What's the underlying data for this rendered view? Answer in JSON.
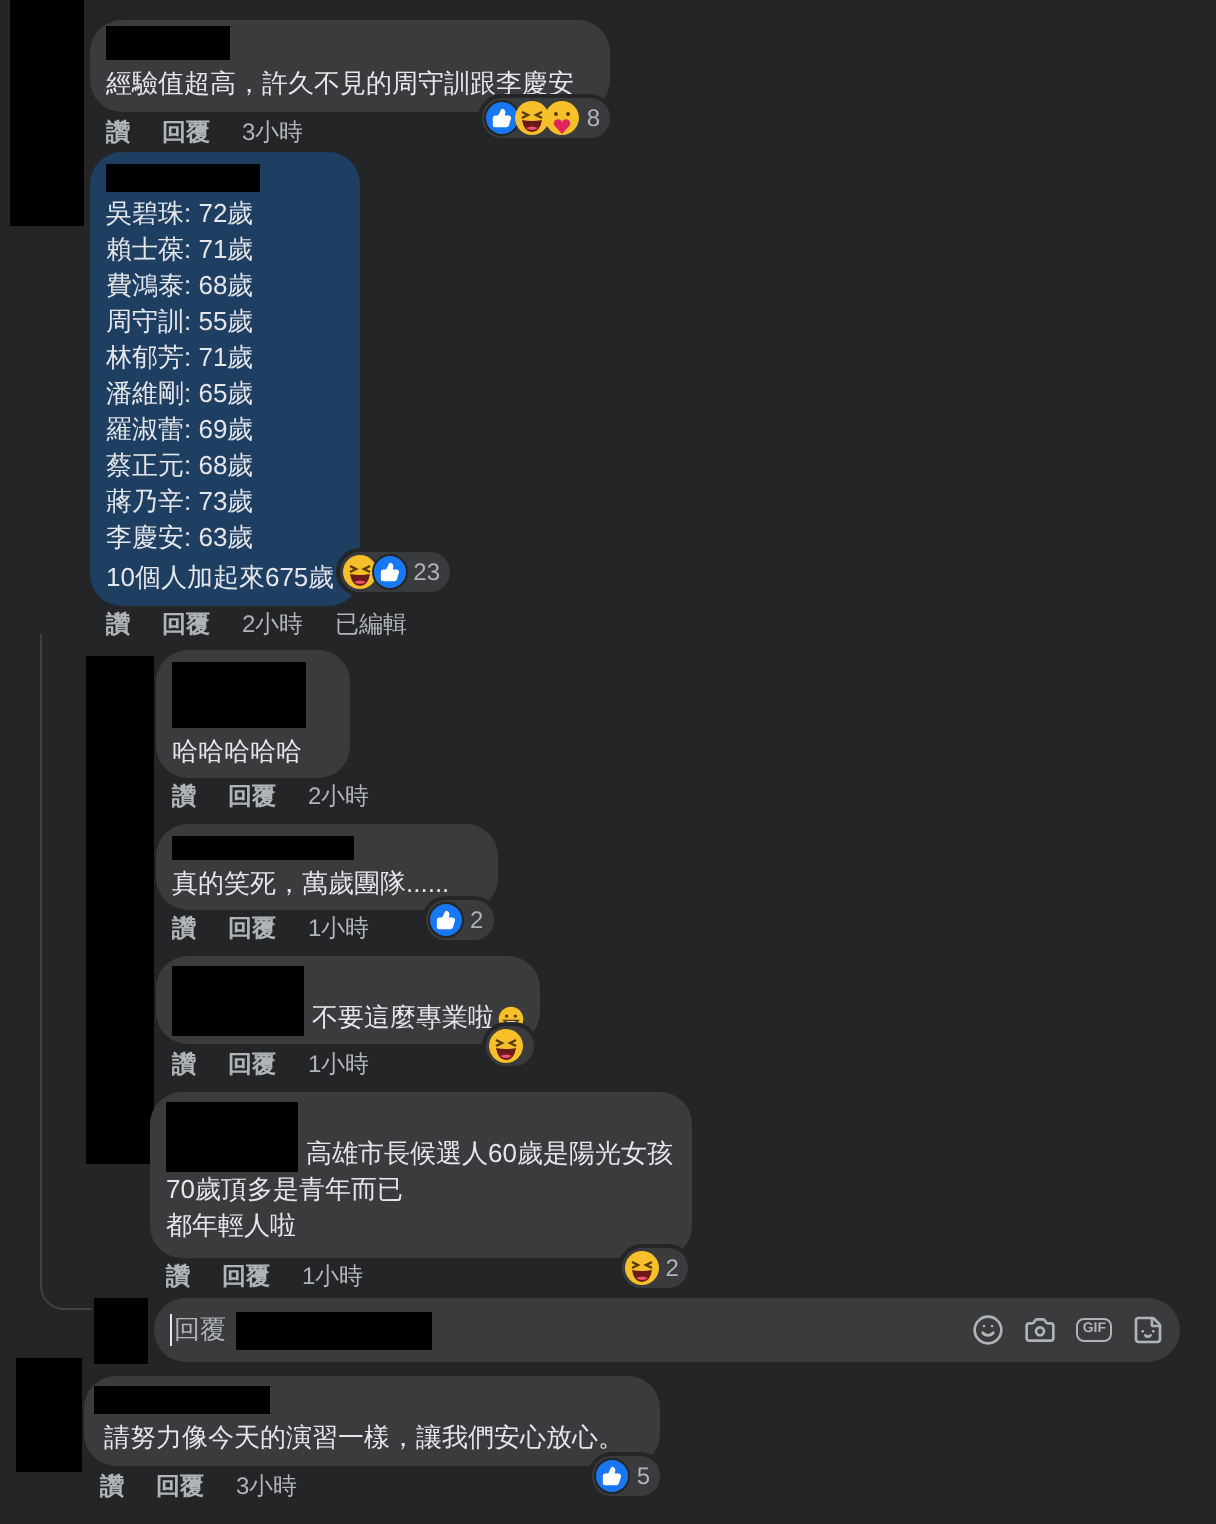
{
  "comments": [
    {
      "lines": [
        "經驗值超高，許久不見的周守訓跟李慶安"
      ],
      "reactions": [
        {
          "kind": "like"
        },
        {
          "kind": "haha"
        },
        {
          "kind": "care"
        }
      ],
      "count": "8",
      "actions": [
        "讚",
        "回覆",
        "3小時"
      ],
      "highlighted": false
    },
    {
      "lines": [
        "吳碧珠: 72歲",
        "賴士葆: 71歲",
        "費鴻泰: 68歲",
        "周守訓: 55歲",
        "林郁芳: 71歲",
        "潘維剛: 65歲",
        "羅淑蕾: 69歲",
        "蔡正元: 68歲",
        "蔣乃辛: 73歲",
        "李慶安: 63歲",
        "10個人加起來675歲"
      ],
      "reactions": [
        {
          "kind": "haha"
        },
        {
          "kind": "like"
        }
      ],
      "count": "23",
      "actions": [
        "讚",
        "回覆",
        "2小時",
        "已編輯"
      ],
      "highlighted": true
    }
  ],
  "replies": [
    {
      "lines": [
        "哈哈哈哈哈"
      ],
      "name_inline": false,
      "actions": [
        "讚",
        "回覆",
        "2小時"
      ]
    },
    {
      "lines": [
        "真的笑死，萬歲團隊......"
      ],
      "name_inline": false,
      "reactions": [
        {
          "kind": "like"
        }
      ],
      "count": "2",
      "actions": [
        "讚",
        "回覆",
        "1小時"
      ]
    },
    {
      "lines": [
        "不要這麼專業啦"
      ],
      "name_inline": true,
      "smiley": true,
      "reactions": [
        {
          "kind": "haha"
        }
      ],
      "actions": [
        "讚",
        "回覆",
        "1小時"
      ]
    },
    {
      "lines": [
        "高雄市長候選人60歲是陽光女孩",
        "70歲頂多是青年而已",
        "都年輕人啦"
      ],
      "name_inline": true,
      "reactions": [
        {
          "kind": "haha"
        }
      ],
      "count": "2",
      "actions": [
        "讚",
        "回覆",
        "1小時"
      ]
    }
  ],
  "reply_box": {
    "placeholder": "回覆",
    "tools": [
      {
        "kind": "emoji"
      },
      {
        "kind": "camera"
      },
      {
        "kind": "gif",
        "label": "GIF"
      },
      {
        "kind": "sticker"
      }
    ]
  },
  "last_comment": {
    "lines": [
      "請努力像今天的演習一樣，讓我們安心放心。"
    ],
    "reactions": [
      {
        "kind": "like"
      }
    ],
    "count": "5",
    "actions": [
      "讚",
      "回覆",
      "3小時"
    ]
  }
}
